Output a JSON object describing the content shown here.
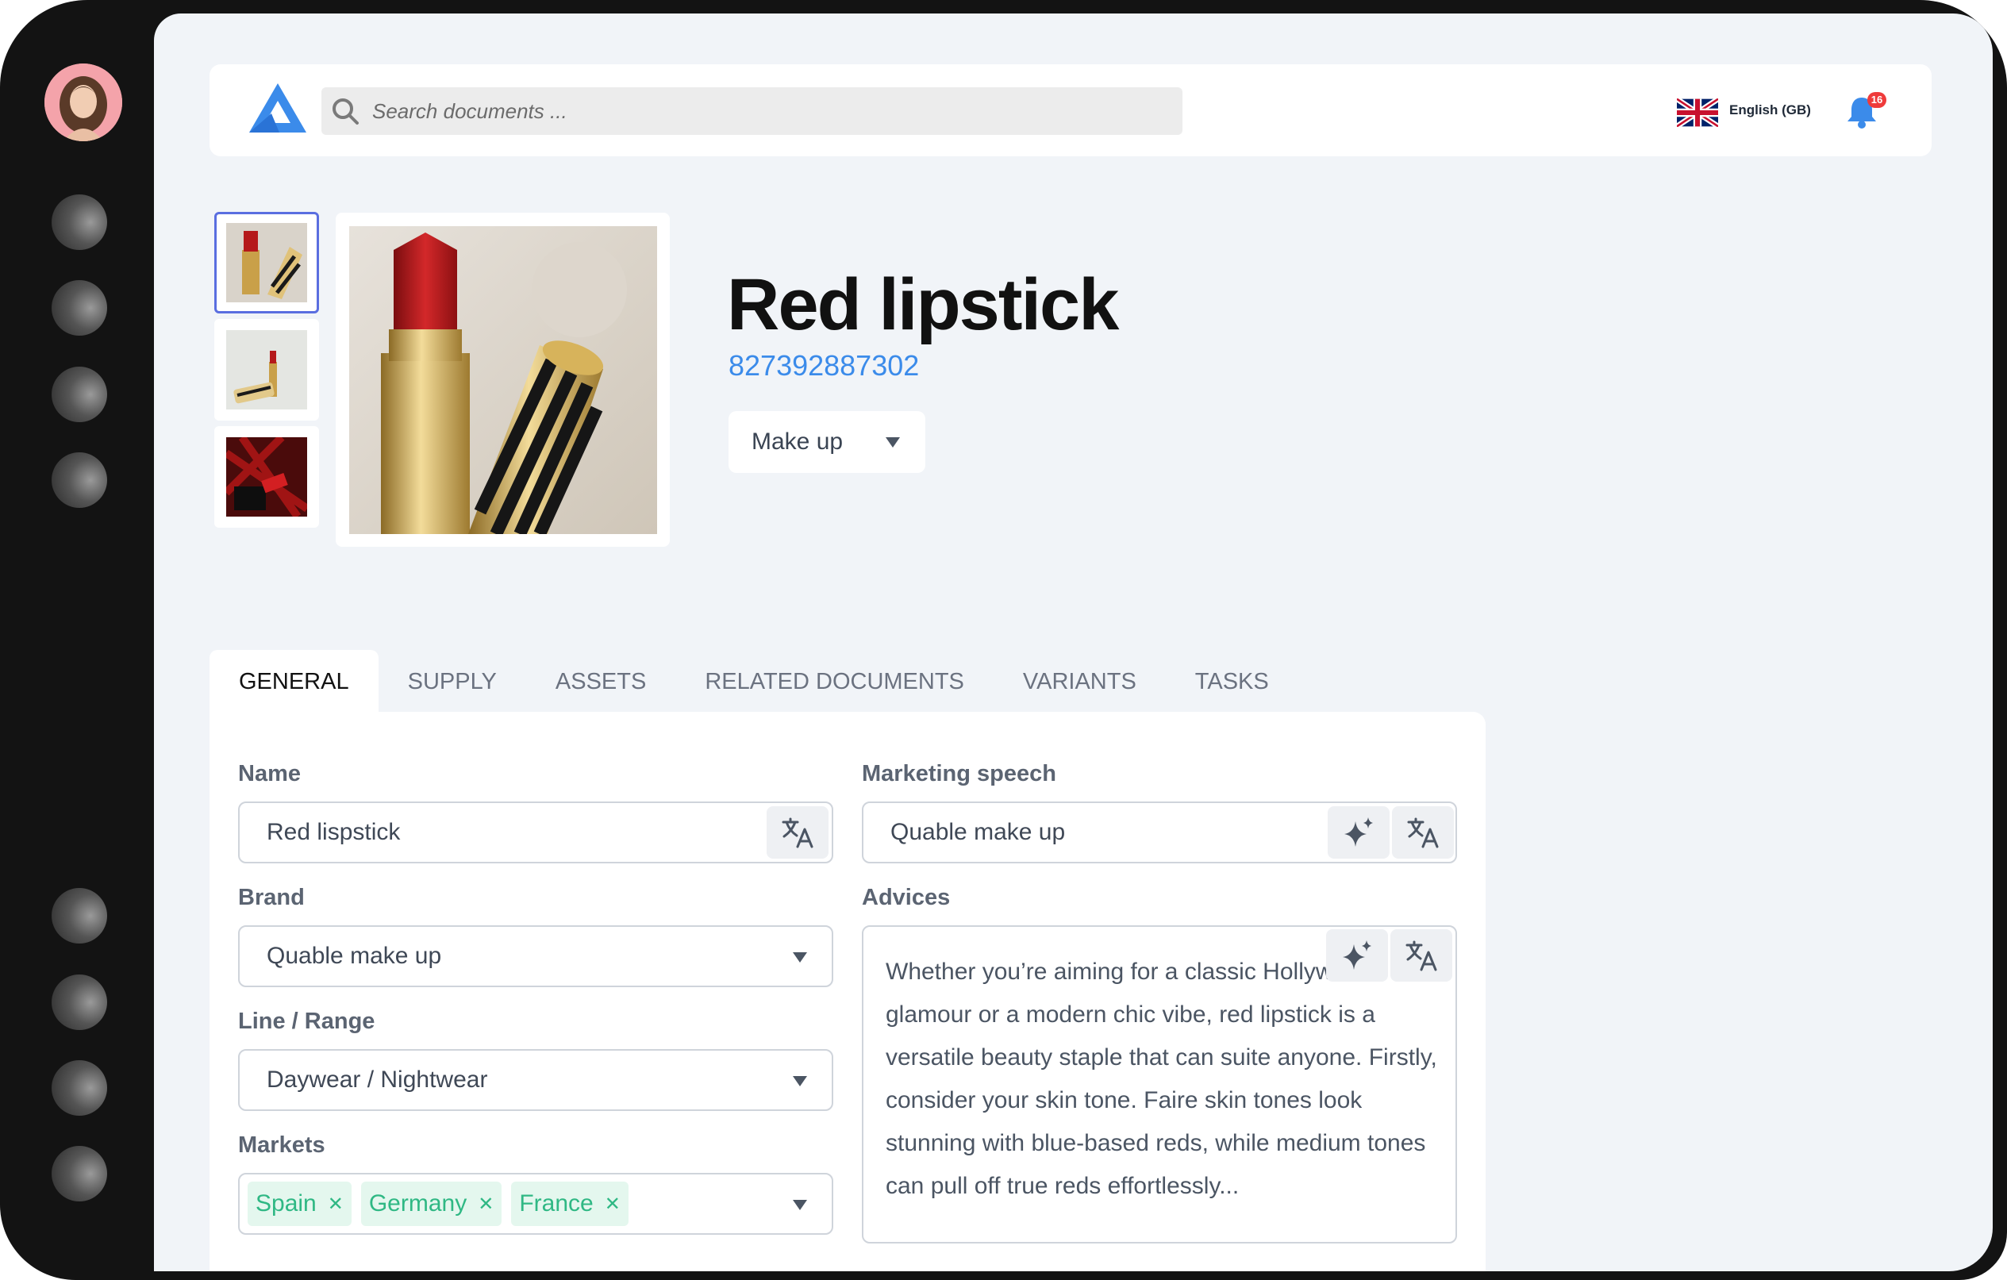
{
  "search": {
    "placeholder": "Search documents ..."
  },
  "language": {
    "label": "English (GB)"
  },
  "notifications": {
    "count": "16"
  },
  "product": {
    "title": "Red lipstick",
    "code": "827392887302",
    "category": "Make up"
  },
  "tabs": [
    "GENERAL",
    "SUPPLY",
    "ASSETS",
    "RELATED DOCUMENTS",
    "VARIANTS",
    "TASKS"
  ],
  "general": {
    "name_label": "Name",
    "name_value": "Red lispstick",
    "brand_label": "Brand",
    "brand_value": "Quable make up",
    "line_label": "Line / Range",
    "line_value": "Daywear / Nightwear",
    "markets_label": "Markets",
    "markets": [
      "Spain",
      "Germany",
      "France"
    ],
    "marketing_label": "Marketing speech",
    "marketing_value": "Quable make up",
    "advices_label": "Advices",
    "advices_value": "Whether you’re aiming for a classic Hollywood glamour or a modern chic vibe, red lipstick is a versatile beauty staple that can suite anyone. Firstly, consider your skin tone. Faire skin tones look stunning with blue-based reds, while medium tones can pull off true reds effortlessly..."
  },
  "icons": {
    "logo": "triangle-logo",
    "search": "search-icon",
    "flag": "uk-flag-icon",
    "bell": "bell-icon",
    "translate": "translate-icon",
    "ai": "sparkle-icon",
    "dropdown": "caret-down-icon",
    "remove": "close-icon"
  },
  "colors": {
    "accent": "#3b8bea",
    "chip_bg": "#e4f7ee",
    "chip_text": "#2fb884",
    "badge": "#ef3b3b",
    "selected_thumb": "#5a6ee0"
  }
}
